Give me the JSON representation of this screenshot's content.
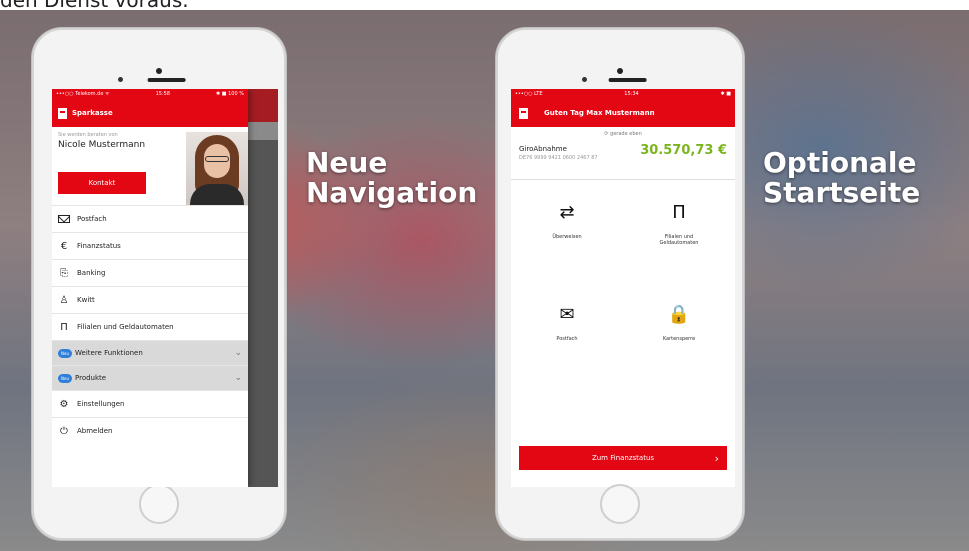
{
  "top_text": "den Dienst voraus.",
  "captions": {
    "left_line1": "Neue",
    "left_line2": "Navigation",
    "right_line1": "Optionale",
    "right_line2": "Startseite"
  },
  "left_phone": {
    "status": {
      "carrier": "•••○○ Telekom.de ᯤ",
      "time": "15:58",
      "battery": "✱ ■ 100 %"
    },
    "brand": "Sparkasse",
    "profile": {
      "hint": "Sie werden beraten von",
      "name": "Nicole Mustermann",
      "contact_label": "Kontakt"
    },
    "menu": [
      {
        "label": "Postfach"
      },
      {
        "label": "Finanzstatus",
        "icon": "€"
      },
      {
        "label": "Banking",
        "icon": "⎘"
      },
      {
        "label": "Kwitt",
        "icon": "♙"
      },
      {
        "label": "Filialen und Geldautomaten",
        "icon": "Π"
      },
      {
        "label": "Weitere Funktionen",
        "badge": "Neu"
      },
      {
        "label": "Produkte",
        "badge": "Neu"
      },
      {
        "label": "Einstellungen",
        "icon": "⚙"
      },
      {
        "label": "Abmelden",
        "icon": "⏻"
      }
    ]
  },
  "right_phone": {
    "status": {
      "carrier": "•••○○ LTE",
      "time": "15:34",
      "battery": "✱ ■"
    },
    "greeting": "Guten Tag Max Mustermann",
    "updated": "⟳ gerade eben",
    "account": {
      "name": "GiroAbnahme",
      "iban": "DE76 9999 9421 0600 2467 87",
      "balance": "30.570,73 €"
    },
    "tiles": [
      {
        "label": "Überweisen",
        "icon": "⇄"
      },
      {
        "label": "Filialen und Geldautomaten",
        "icon": "Π"
      },
      {
        "label": "Postfach",
        "icon": "✉"
      },
      {
        "label": "Kartensperre",
        "icon": "🔒"
      }
    ],
    "cta_label": "Zum Finanzstatus",
    "cta_arrow": "›"
  }
}
